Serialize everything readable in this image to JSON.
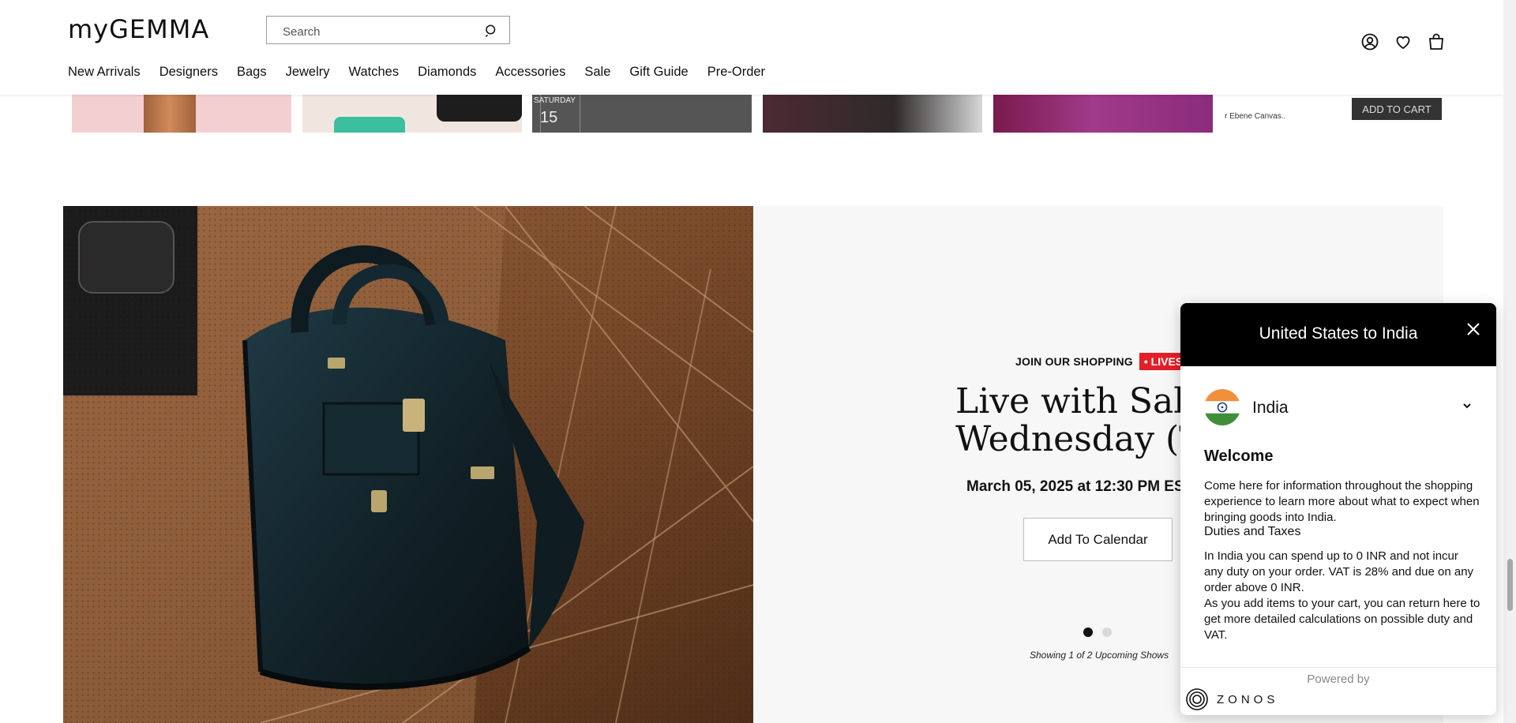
{
  "header": {
    "logo": "myGEMMA",
    "search_placeholder": "Search",
    "nav": [
      "New Arrivals",
      "Designers",
      "Bags",
      "Jewelry",
      "Watches",
      "Diamonds",
      "Accessories",
      "Sale",
      "Gift Guide",
      "Pre-Order"
    ]
  },
  "strip": {
    "thumb3_label": "SATURDAY",
    "thumb3_day": "15",
    "thumb6_text": "r Ebene Canvas..",
    "thumb6_cart": "ADD TO CART"
  },
  "show": {
    "join_label": "JOIN OUR SHOPPING",
    "live_label": "• LIVES",
    "title_line1": "Live with Sabri",
    "title_line2": "Wednesday (Tik",
    "date": "March 05, 2025 at 12:30 PM EST",
    "calendar_button": "Add To Calendar",
    "showing": "Showing 1 of 2 Upcoming Shows",
    "active_slide": 1,
    "slide_count": 2
  },
  "modal": {
    "title": "United States to India",
    "country": "India",
    "welcome": "Welcome",
    "intro": "Come here for information throughout the shopping experience to learn more about what to expect when bringing goods into India.",
    "duties_heading": "Duties and Taxes",
    "duties_text": "In India you can spend up to 0 INR and not incur any duty on your order. VAT is 28% and due on any order above 0 INR.",
    "return_text": "As you add items to your cart, you can return here to get more detailed calculations on possible duty and VAT.",
    "powered_by": "Powered by",
    "brand": "ZONOS"
  },
  "colors": {
    "live_badge": "#e41e26",
    "modal_header": "#000000",
    "panel_bg": "#f7f7f7"
  }
}
